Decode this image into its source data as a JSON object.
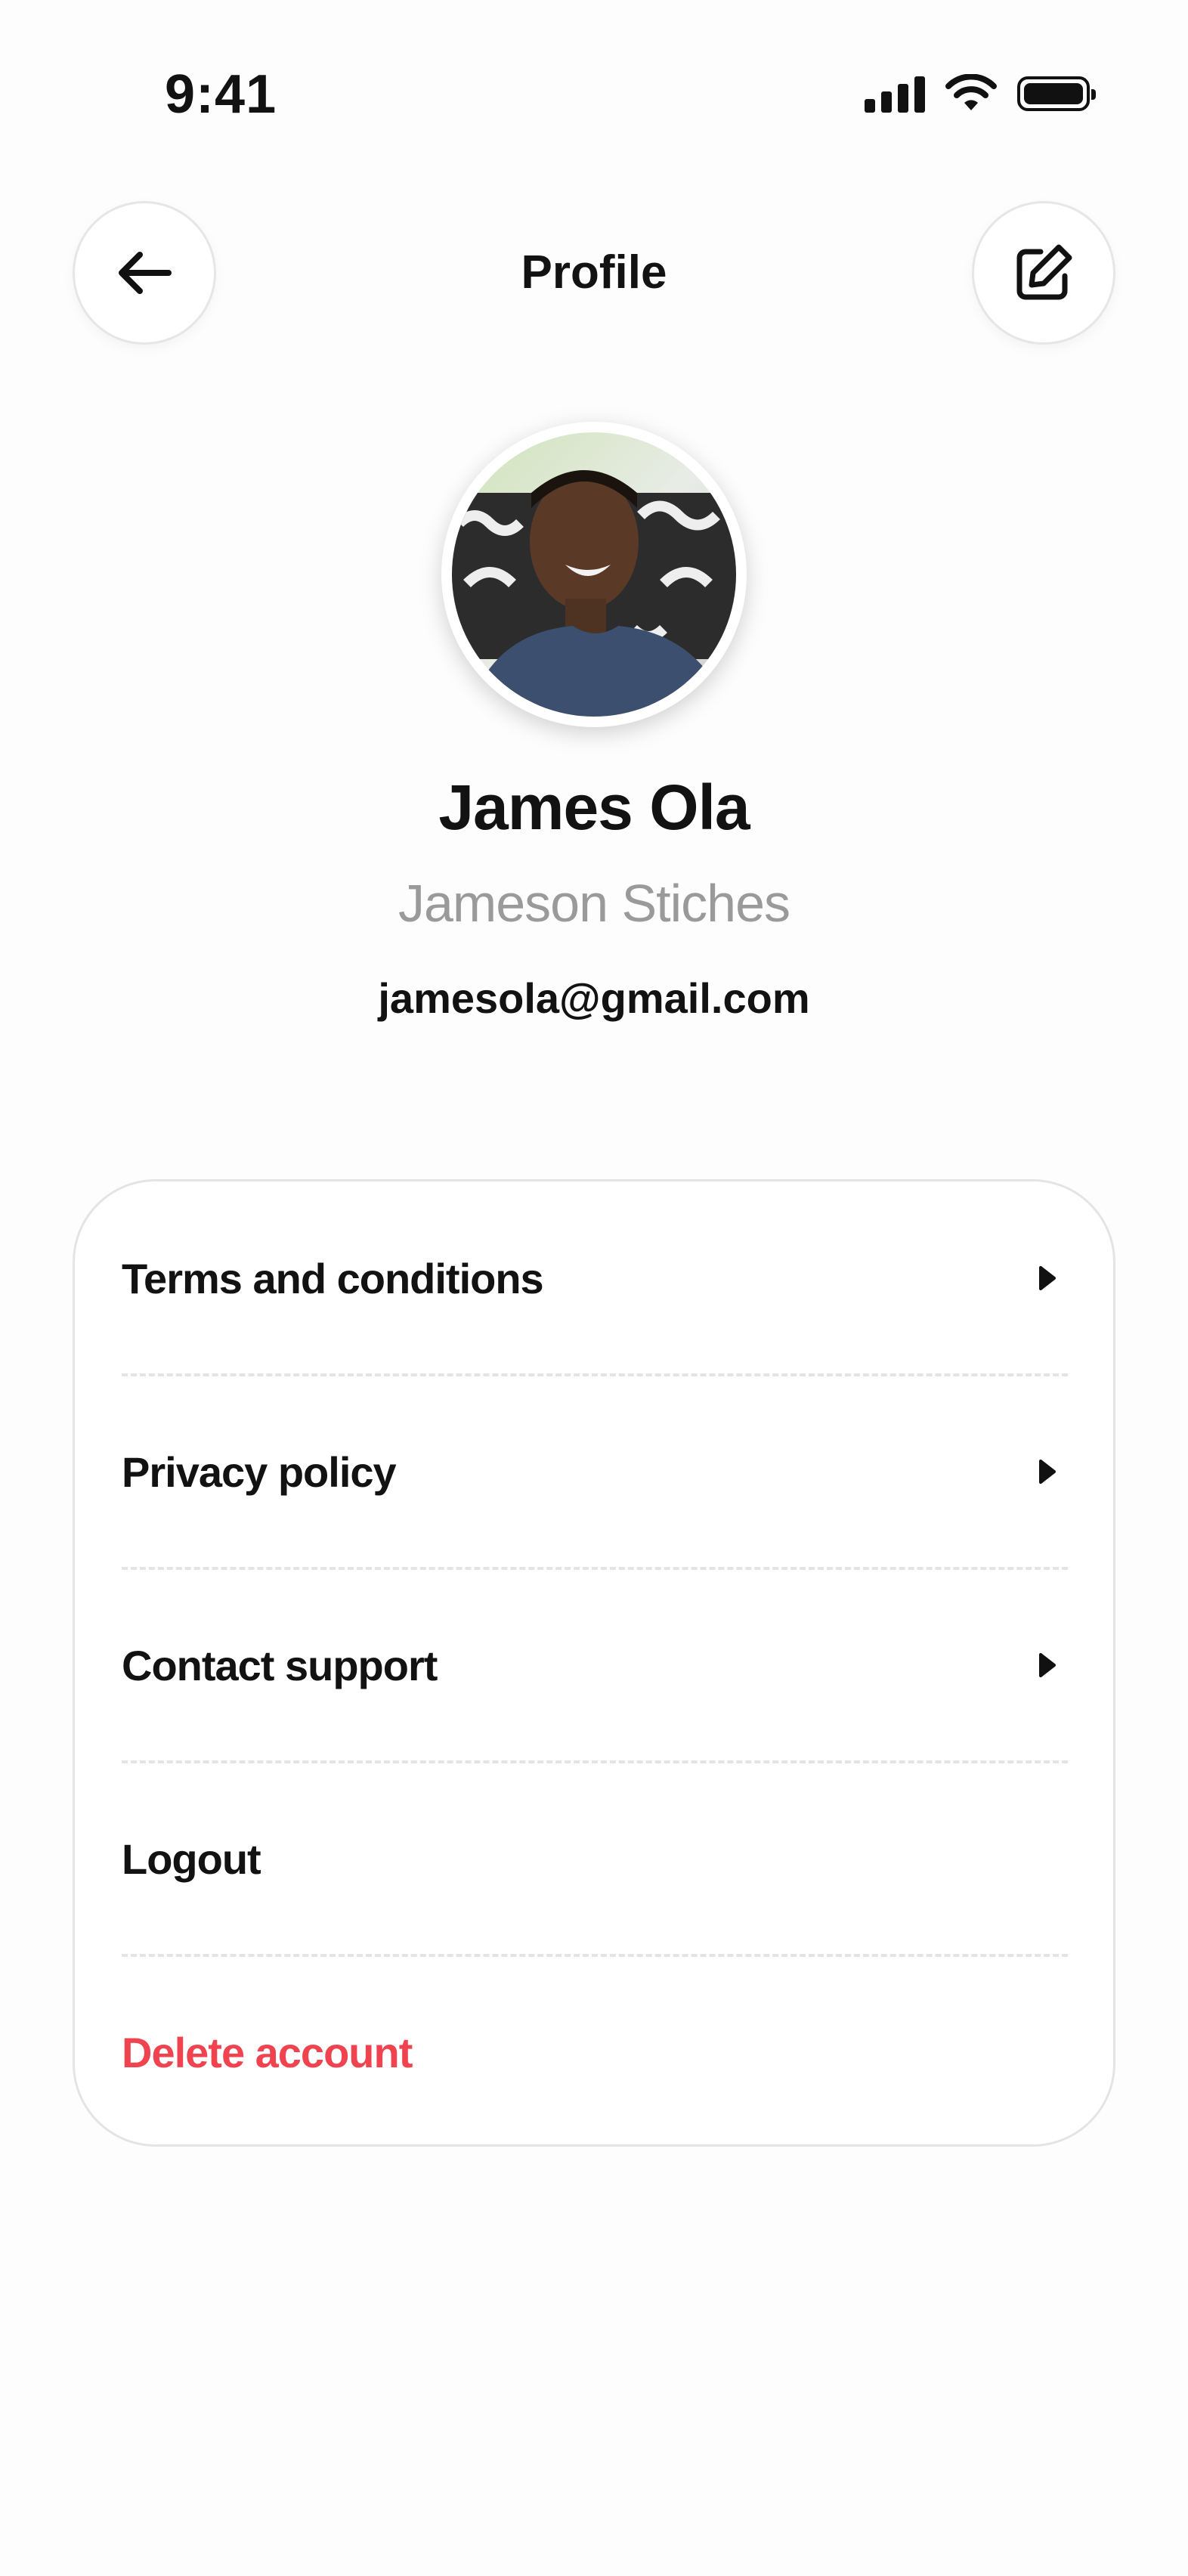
{
  "status_bar": {
    "time": "9:41"
  },
  "header": {
    "title": "Profile"
  },
  "profile": {
    "name": "James Ola",
    "business_name": "Jameson Stiches",
    "email": "jamesola@gmail.com"
  },
  "menu": {
    "items": [
      {
        "label": "Terms and conditions",
        "has_arrow": true
      },
      {
        "label": "Privacy policy",
        "has_arrow": true
      },
      {
        "label": "Contact support",
        "has_arrow": true
      },
      {
        "label": "Logout",
        "has_arrow": false
      },
      {
        "label": "Delete account",
        "has_arrow": false,
        "color": "#ef4350"
      }
    ]
  },
  "icons": {
    "back": "arrow-left-icon",
    "edit": "edit-icon",
    "chevron": "caret-right-icon"
  },
  "colors": {
    "danger": "#ef4350",
    "muted": "#9a9a9a",
    "text": "#121212"
  }
}
